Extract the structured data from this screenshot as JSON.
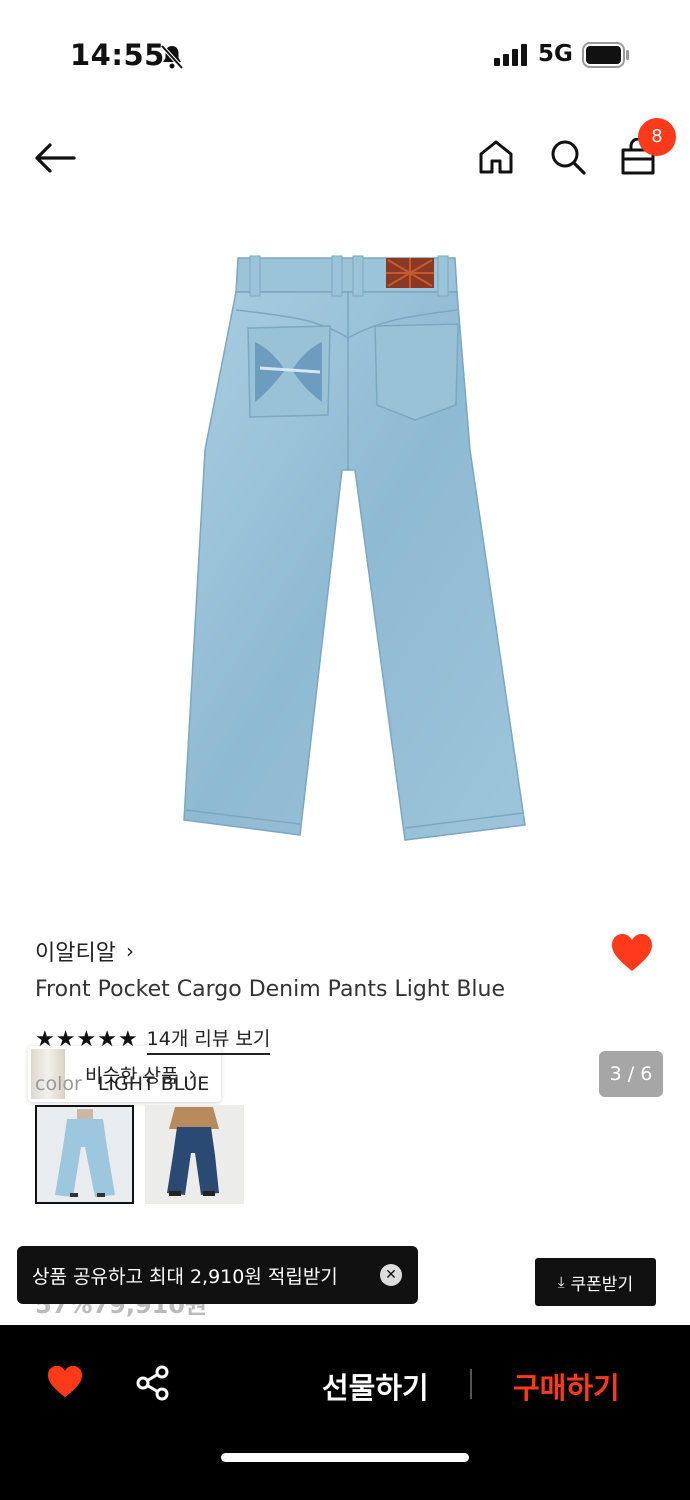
{
  "status_bar": {
    "time": "14:55",
    "network": "5G"
  },
  "header": {
    "cart_count": "8"
  },
  "gallery": {
    "similar_label": "비슷한 상품",
    "counter": "3 / 6"
  },
  "product": {
    "brand": "이알티알",
    "title": "Front Pocket Cargo Denim Pants Light Blue",
    "rating_stars": 5,
    "reviews_link": "14개 리뷰 보기",
    "color_label": "color",
    "color_value": "LIGHT BLUE",
    "price_peek": "57%79,910원"
  },
  "toast": {
    "text": "상품 공유하고 최대 2,910원 적립받기"
  },
  "coupon": {
    "label": "쿠폰받기"
  },
  "bottom_bar": {
    "gift_label": "선물하기",
    "buy_label": "구매하기"
  },
  "colors": {
    "accent": "#ff3a1a",
    "bar_bg": "#000000",
    "denim_light": "#9cc3d8",
    "denim_dark": "#2a4a73"
  },
  "icons": [
    "bell-slash-icon",
    "signal-icon",
    "battery-icon",
    "back-arrow-icon",
    "home-icon",
    "search-icon",
    "shopping-bag-icon",
    "heart-icon",
    "share-icon",
    "close-icon",
    "download-icon",
    "chevron-right-icon",
    "star-icon"
  ]
}
